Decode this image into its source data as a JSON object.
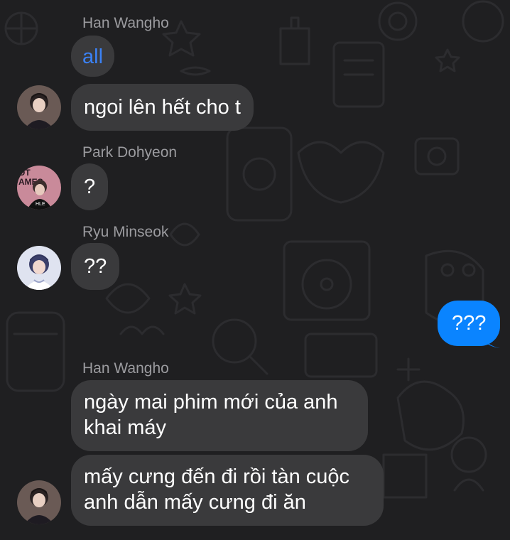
{
  "messages": [
    {
      "sender": "Han Wangho",
      "text": "all"
    },
    {
      "text": "ngoi lên hết cho t"
    },
    {
      "sender": "Park Dohyeon",
      "text": "?"
    },
    {
      "sender": "Ryu Minseok",
      "text": "??"
    },
    {
      "text": "???",
      "outgoing": true
    },
    {
      "sender": "Han Wangho",
      "text": "ngày mai phim mới của anh khai máy",
      "lines": [
        "ngày mai phim mới của anh",
        "khai máy"
      ]
    },
    {
      "text": "mấy cưng đến đi rồi tàn cuộc anh dẫn mấy cưng đi ăn",
      "lines": [
        "mấy cưng đến đi rồi tàn cuộc",
        "anh dẫn mấy cưng đi ăn"
      ]
    }
  ],
  "avatar_art": {
    "park_dohyeon": "OT AMES"
  },
  "colors": {
    "background": "#1f1f21",
    "incoming_bubble": "#3a3a3c",
    "outgoing_bubble": "#0a84ff",
    "sender_name": "#9b9b9f",
    "link_text": "#3b82f6"
  }
}
